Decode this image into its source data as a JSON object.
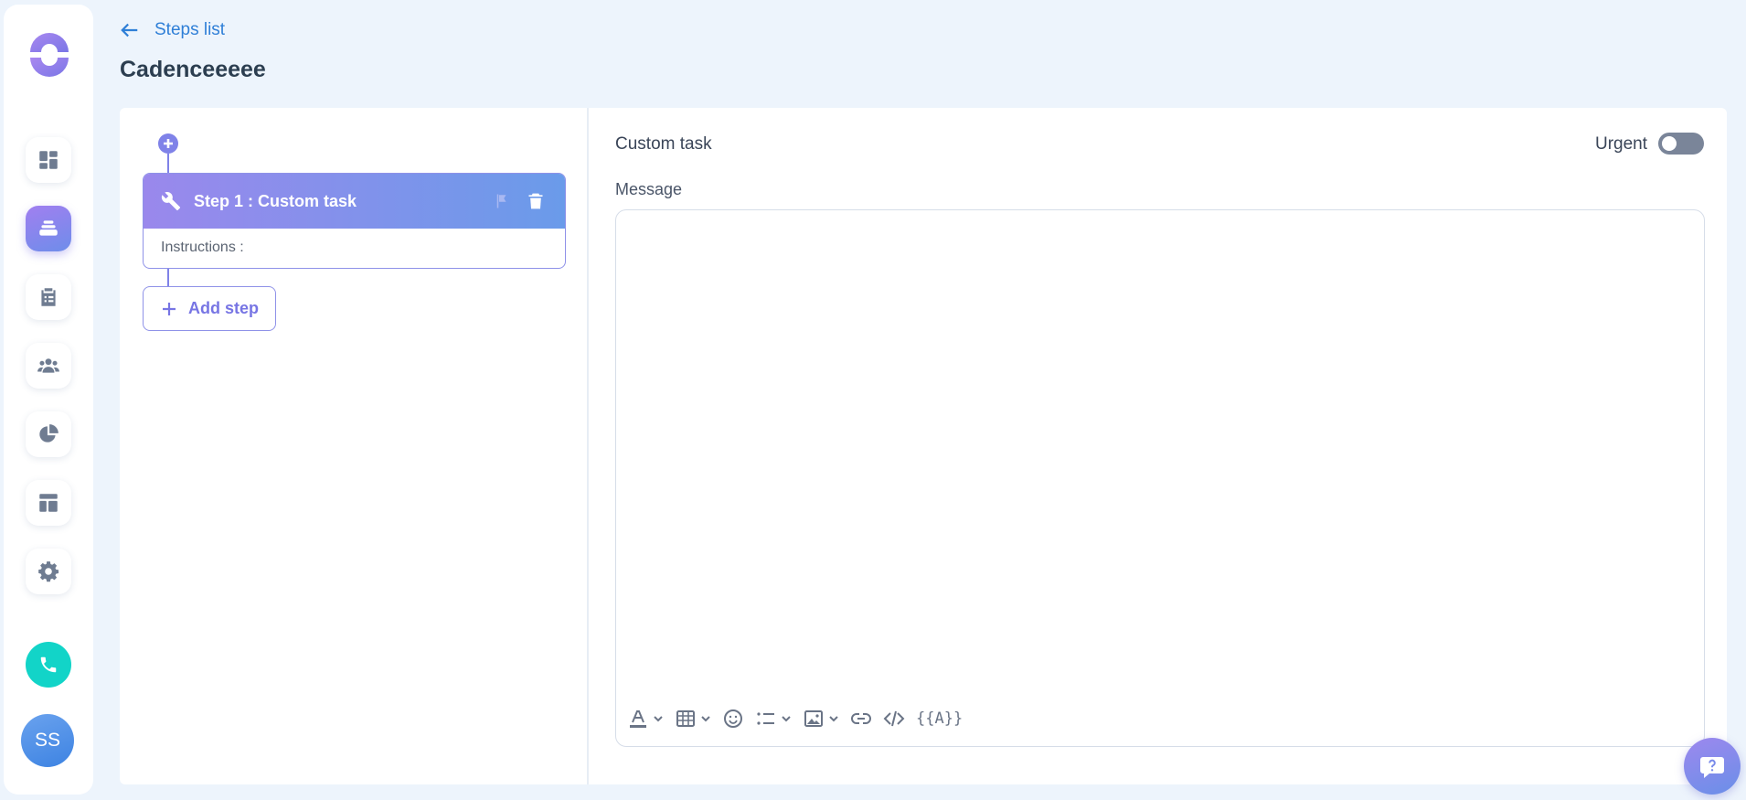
{
  "header": {
    "back_label": "Steps list",
    "title": "Cadenceeeee"
  },
  "sidebar": {
    "items": [
      {
        "name": "dashboard-icon"
      },
      {
        "name": "cadences-icon",
        "active": true
      },
      {
        "name": "tasks-clipboard-icon"
      },
      {
        "name": "contacts-group-icon"
      },
      {
        "name": "reports-pie-icon"
      },
      {
        "name": "templates-layout-icon"
      },
      {
        "name": "settings-gear-icon"
      }
    ],
    "phone_icon": "phone-icon",
    "avatar_initials": "SS"
  },
  "steps": [
    {
      "title": "Step 1 : Custom task",
      "instructions_label": "Instructions :"
    }
  ],
  "add_step_label": "Add step",
  "task": {
    "title": "Custom task",
    "urgent_label": "Urgent",
    "urgent_on": false,
    "message_label": "Message",
    "message_value": "",
    "variable_button": "{{A}}"
  },
  "colors": {
    "accent_purple": "#7f82e8",
    "link_blue": "#2f7fd7",
    "phone_teal": "#12d4c8",
    "background": "#edf4fc"
  }
}
